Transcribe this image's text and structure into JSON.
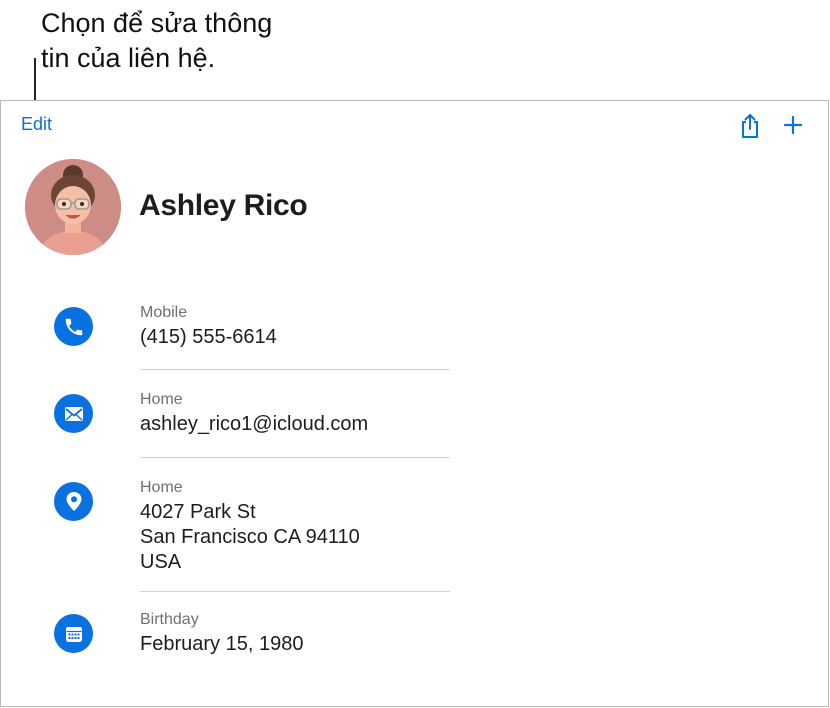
{
  "callout": {
    "line1": "Chọn để sửa thông",
    "line2": "tin của liên hệ."
  },
  "toolbar": {
    "edit_label": "Edit",
    "share_icon": "share-icon",
    "add_icon": "plus-icon"
  },
  "contact": {
    "name": "Ashley Rico",
    "avatar": "memoji-avatar"
  },
  "fields": [
    {
      "icon": "phone-icon",
      "label": "Mobile",
      "lines": [
        "(415) 555-6614"
      ]
    },
    {
      "icon": "mail-icon",
      "label": "Home",
      "lines": [
        "ashley_rico1@icloud.com"
      ]
    },
    {
      "icon": "location-icon",
      "label": "Home",
      "lines": [
        "4027 Park St",
        "San Francisco CA 94110",
        "USA"
      ]
    },
    {
      "icon": "calendar-icon",
      "label": "Birthday",
      "lines": [
        "February 15, 1980"
      ]
    }
  ],
  "colors": {
    "accent": "#0a72e0",
    "avatar_bg": "#cd8c86",
    "label": "#707075",
    "divider": "#d2d2d6"
  }
}
